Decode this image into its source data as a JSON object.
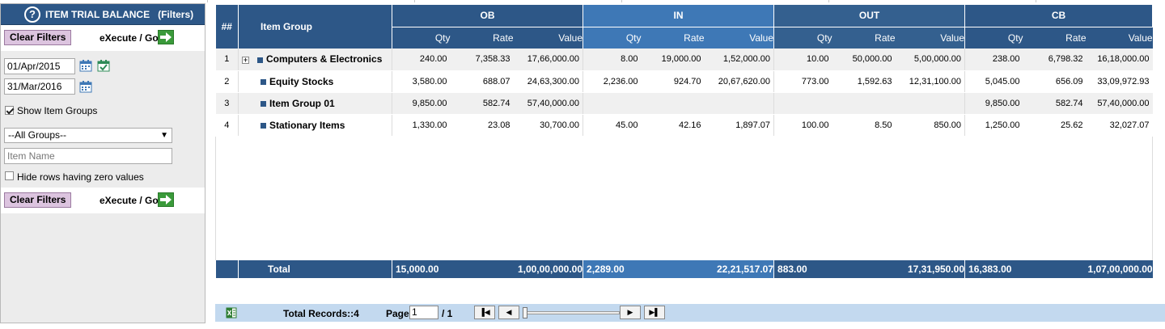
{
  "panel": {
    "help_icon": "?",
    "title": "ITEM TRIAL BALANCE",
    "subtitle": "(Filters)",
    "clear_label": "Clear Filters",
    "execute_label": "eXecute / Go",
    "from_date": "01/Apr/2015",
    "to_date": "31/Mar/2016",
    "show_groups_label": "Show Item Groups",
    "show_groups_checked": true,
    "group_select_value": "--All Groups--",
    "item_name_placeholder": "Item Name",
    "hide_zero_label": "Hide rows having zero values",
    "hide_zero_checked": false
  },
  "grid": {
    "hash_header": "##",
    "group_header": "Item Group",
    "sections": [
      "OB",
      "IN",
      "OUT",
      "CB"
    ],
    "subheaders": [
      "Qty",
      "Rate",
      "Value"
    ],
    "rows": [
      {
        "num": "1",
        "expandable": true,
        "group": "Computers & Electronics",
        "ob": [
          "240.00",
          "7,358.33",
          "17,66,000.00"
        ],
        "in": [
          "8.00",
          "19,000.00",
          "1,52,000.00"
        ],
        "out": [
          "10.00",
          "50,000.00",
          "5,00,000.00"
        ],
        "cb": [
          "238.00",
          "6,798.32",
          "16,18,000.00"
        ]
      },
      {
        "num": "2",
        "expandable": false,
        "group": "Equity Stocks",
        "ob": [
          "3,580.00",
          "688.07",
          "24,63,300.00"
        ],
        "in": [
          "2,236.00",
          "924.70",
          "20,67,620.00"
        ],
        "out": [
          "773.00",
          "1,592.63",
          "12,31,100.00"
        ],
        "cb": [
          "5,045.00",
          "656.09",
          "33,09,972.93"
        ]
      },
      {
        "num": "3",
        "expandable": false,
        "group": "Item Group 01",
        "ob": [
          "9,850.00",
          "582.74",
          "57,40,000.00"
        ],
        "in": [
          "",
          "",
          ""
        ],
        "out": [
          "",
          "",
          ""
        ],
        "cb": [
          "9,850.00",
          "582.74",
          "57,40,000.00"
        ]
      },
      {
        "num": "4",
        "expandable": false,
        "group": "Stationary Items",
        "ob": [
          "1,330.00",
          "23.08",
          "30,700.00"
        ],
        "in": [
          "45.00",
          "42.16",
          "1,897.07"
        ],
        "out": [
          "100.00",
          "8.50",
          "850.00"
        ],
        "cb": [
          "1,250.00",
          "25.62",
          "32,027.07"
        ]
      }
    ],
    "total": {
      "label": "Total",
      "ob_qty": "15,000.00",
      "ob_value": "1,00,00,000.00",
      "in_qty": "2,289.00",
      "in_value": "22,21,517.07",
      "out_qty": "883.00",
      "out_value": "17,31,950.00",
      "cb_qty": "16,383.00",
      "cb_value": "1,07,00,000.00"
    }
  },
  "pager": {
    "total_records": "Total Records::4",
    "page_label": "Page",
    "page_value": "1",
    "page_of": "/ 1",
    "first_glyph": "▐◀",
    "prev_glyph": "◀",
    "next_glyph": "▶",
    "last_glyph": "▶▌"
  },
  "colors": {
    "header": "#2d5787",
    "header_in": "#3e78b6",
    "pager_bg": "#c3d9ef",
    "clear_button": "#dcc4df",
    "go_button": "#3a9a3a"
  }
}
